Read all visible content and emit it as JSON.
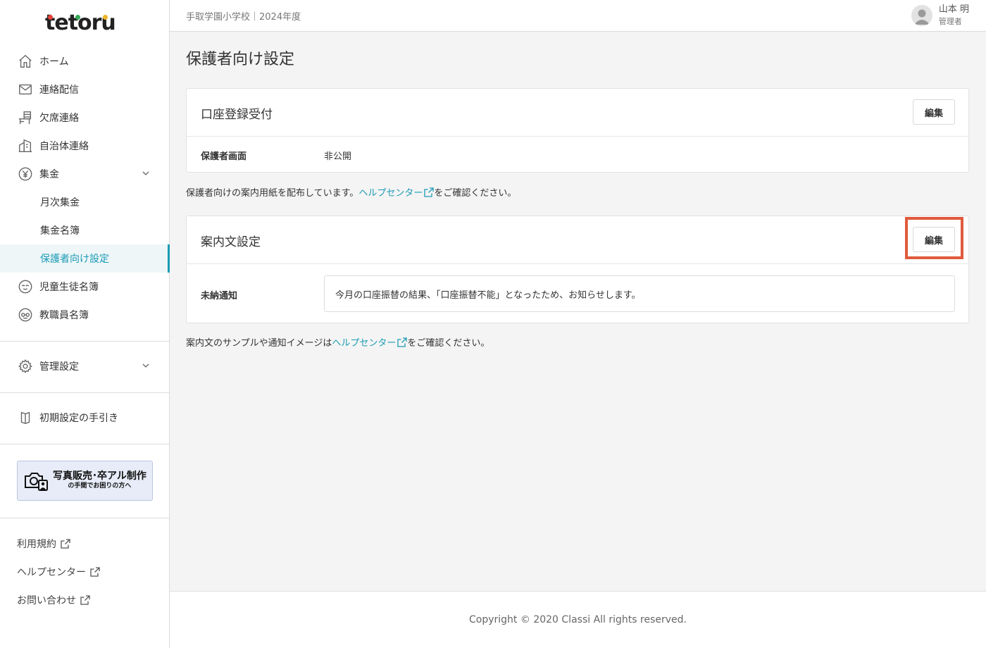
{
  "app": {
    "logo_text": "tetoru"
  },
  "sidebar": {
    "items": [
      {
        "label": "ホーム",
        "icon": "home-icon"
      },
      {
        "label": "連絡配信",
        "icon": "mail-icon"
      },
      {
        "label": "欠席連絡",
        "icon": "desk-icon"
      },
      {
        "label": "自治体連絡",
        "icon": "building-icon"
      },
      {
        "label": "集金",
        "icon": "yen-icon"
      },
      {
        "label": "月次集金"
      },
      {
        "label": "集金名簿"
      },
      {
        "label": "保護者向け設定",
        "active": true
      },
      {
        "label": "児童生徒名簿",
        "icon": "student-icon"
      },
      {
        "label": "教職員名簿",
        "icon": "teacher-icon"
      }
    ],
    "admin": {
      "label": "管理設定",
      "icon": "gear-icon"
    },
    "guide": {
      "label": "初期設定の手引き",
      "icon": "book-icon"
    },
    "banner": {
      "title": "写真販売･卒アル制作",
      "subtitle": "の手間でお困りの方へ",
      "icon": "camera-icon"
    },
    "footer_links": [
      {
        "label": "利用規約"
      },
      {
        "label": "ヘルプセンター"
      },
      {
        "label": "お問い合わせ"
      }
    ]
  },
  "header": {
    "school": "手取学園小学校｜2024年度",
    "user_name": "山本 明",
    "user_role": "管理者"
  },
  "main": {
    "title": "保護者向け設定",
    "account_card": {
      "title": "口座登録受付",
      "edit_label": "編集",
      "row_label": "保護者画面",
      "row_value": "非公開"
    },
    "note1": {
      "before": "保護者向けの案内用紙を配布しています。",
      "link": "ヘルプセンター",
      "after": "をご確認ください。"
    },
    "message_card": {
      "title": "案内文設定",
      "edit_label": "編集",
      "row_label": "未納通知",
      "row_value": "今月の口座振替の結果、「口座振替不能」となったため、お知らせします。"
    },
    "note2": {
      "before": "案内文のサンプルや通知イメージは",
      "link": "ヘルプセンター",
      "after": "をご確認ください。"
    }
  },
  "footer": {
    "copyright": "Copyright © 2020 Classi All rights reserved."
  },
  "colors": {
    "accent": "#1a9bb4",
    "highlight": "#e05a3c"
  }
}
